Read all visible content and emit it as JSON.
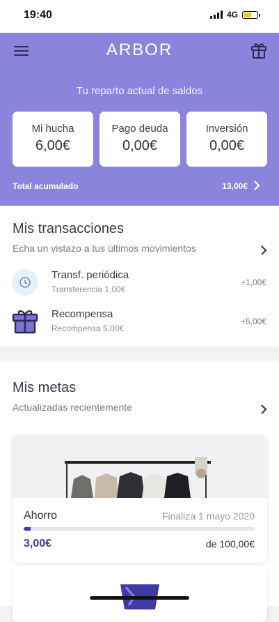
{
  "status": {
    "time": "19:40",
    "network": "4G",
    "battery_level": 0.5
  },
  "header": {
    "logo": "ARBOR",
    "menu_icon": "hamburger-icon",
    "gift_icon": "gift-icon"
  },
  "balance": {
    "title": "Tu reparto actual de saldos",
    "cards": [
      {
        "label": "Mi hucha",
        "amount": "6,00€"
      },
      {
        "label": "Pago deuda",
        "amount": "0,00€"
      },
      {
        "label": "Inversión",
        "amount": "0,00€"
      }
    ],
    "total_label": "Total acumulado",
    "total_amount": "13,00€"
  },
  "transactions": {
    "title": "Mis transacciones",
    "subtitle": "Echa un vistazo a tus últimos movimientos",
    "items": [
      {
        "title": "Transf. periódica",
        "subtitle": "Transferencia 1,00€",
        "amount": "+1,00€",
        "icon": "clock-icon"
      },
      {
        "title": "Recompensa",
        "subtitle": "Recompensa 5,00€",
        "amount": "+5,00€",
        "icon": "gift-icon"
      }
    ]
  },
  "goals": {
    "title": "Mis metas",
    "subtitle": "Actualizadas recientemente",
    "card": {
      "name": "Ahorro",
      "end_date": "Finaliza 1 mayo 2020",
      "saved": "3,00€",
      "target": "de 100,00€",
      "progress": 0.03
    }
  },
  "colors": {
    "accent": "#8b84dc",
    "primary": "#3f3aa6",
    "icon_dark": "#2f2b55"
  }
}
